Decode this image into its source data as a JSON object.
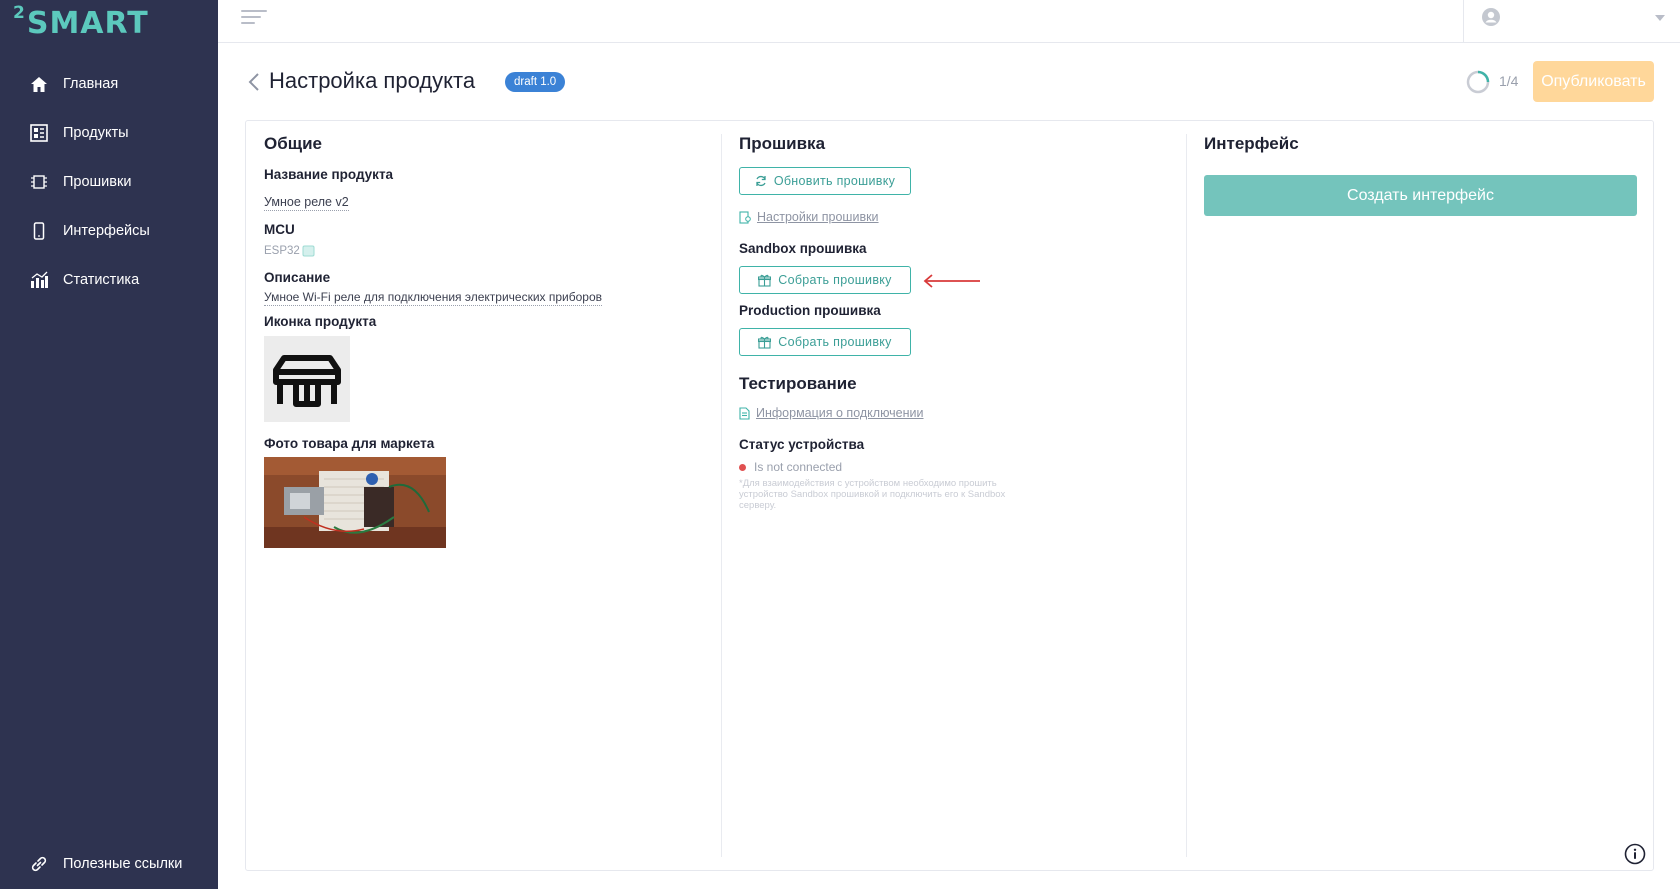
{
  "brand": {
    "logo_prefix": "2",
    "logo_text": "SMART",
    "accent": "#5cc9bd"
  },
  "sidebar": {
    "items": [
      {
        "label": "Главная",
        "icon": "home-icon"
      },
      {
        "label": "Продукты",
        "icon": "products-icon"
      },
      {
        "label": "Прошивки",
        "icon": "chip-icon"
      },
      {
        "label": "Интерфейсы",
        "icon": "phone-icon"
      },
      {
        "label": "Статистика",
        "icon": "stats-icon"
      }
    ],
    "footer": {
      "label": "Полезные ссылки",
      "icon": "link-icon"
    }
  },
  "header": {
    "title": "Настройка продукта",
    "badge": "draft 1.0",
    "progress": "1/4",
    "progress_fraction": 0.25,
    "publish_label": "Опубликовать"
  },
  "general": {
    "heading": "Общие",
    "name_label": "Название продукта",
    "name_value": "Умное реле v2",
    "mcu_label": "MCU",
    "mcu_value": "ESP32",
    "desc_label": "Описание",
    "desc_value": "Умное Wi-Fi реле для подключения электрических приборов",
    "icon_label": "Иконка продукта",
    "photo_label": "Фото товара для маркета"
  },
  "firmware": {
    "heading": "Прошивка",
    "update_label": "Обновить прошивку",
    "settings_link": "Настройки прошивки",
    "sandbox_label": "Sandbox прошивка",
    "sandbox_build": "Собрать прошивку",
    "production_label": "Production прошивка",
    "production_build": "Собрать прошивку"
  },
  "testing": {
    "heading": "Тестирование",
    "info_link": "Информация о подключении",
    "status_label": "Статус устройства",
    "status_value": "Is not connected",
    "status_color": "#e05050",
    "hint": "*Для взаимодействия с устройством необходимо прошить устройство Sandbox прошивкой и подключить его к Sandbox серверу."
  },
  "interface": {
    "heading": "Интерфейс",
    "create_label": "Создать интерфейс"
  }
}
